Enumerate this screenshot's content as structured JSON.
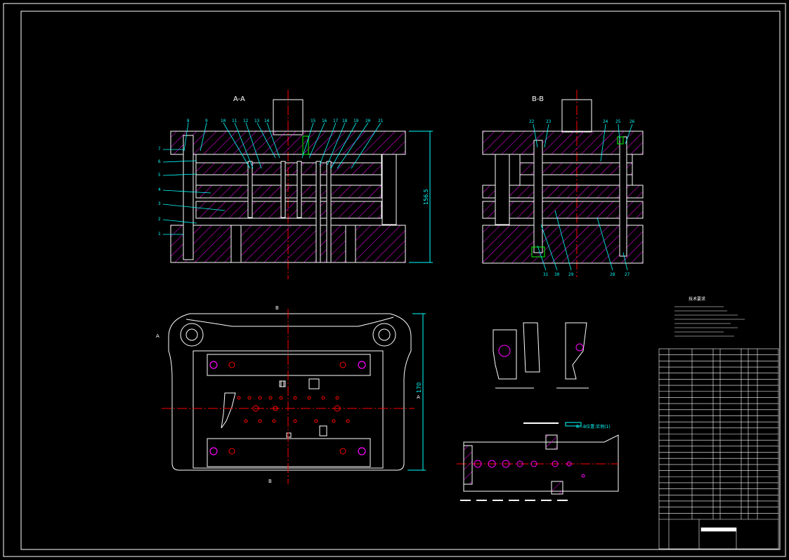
{
  "views": {
    "section_aa": "A-A",
    "section_bb": "B-B",
    "dim_height": "156.5",
    "dim_width": "170",
    "section_mark_b": "B",
    "section_mark_a": "A",
    "strip_label": "B—B位置:实例(1)"
  },
  "colors": {
    "hatch": "#ff00ff",
    "outline": "#ffffff",
    "leader": "#00ffff",
    "center": "#ff0000",
    "green": "#00ff00"
  },
  "labels_left": [
    "7",
    "6",
    "5",
    "4",
    "3",
    "2",
    "1"
  ],
  "labels_top_aa": [
    "8",
    "9",
    "10",
    "11",
    "12",
    "13",
    "14",
    "15",
    "16",
    "17",
    "18",
    "19",
    "20",
    "21"
  ],
  "labels_top_bb": [
    "22",
    "23",
    "24",
    "25",
    "26"
  ],
  "labels_bottom_bb": [
    "31",
    "30",
    "29",
    "28",
    "27"
  ],
  "notes": {
    "heading": "技术要求"
  },
  "title_block": {
    "rows": 28
  }
}
